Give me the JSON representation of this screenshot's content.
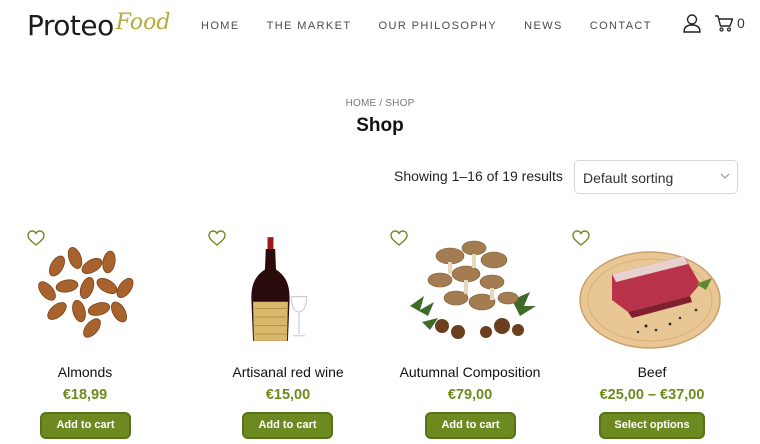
{
  "brand": {
    "name": "Proteo",
    "script": "Food"
  },
  "nav": [
    "HOME",
    "THE MARKET",
    "OUR PHILOSOPHY",
    "NEWS",
    "CONTACT"
  ],
  "header": {
    "cart_count": "0",
    "user_icon": "user-icon",
    "cart_icon": "cart-icon"
  },
  "page": {
    "breadcrumb": "HOME / SHOP",
    "title": "Shop"
  },
  "toolbar": {
    "result_count": "Showing 1–16 of 19 results",
    "sorting": "Default sorting"
  },
  "colors": {
    "accent": "#6d8a21",
    "logo_script": "#b6a93a"
  },
  "products": [
    {
      "name": "Almonds",
      "price": "€18,99",
      "button": "Add to cart"
    },
    {
      "name": "Artisanal red wine",
      "price": "€15,00",
      "button": "Add to cart"
    },
    {
      "name": "Autumnal Composition",
      "price": "€79,00",
      "button": "Add to cart"
    },
    {
      "name": "Beef",
      "price": "€25,00 – €37,00",
      "button": "Select options"
    }
  ]
}
